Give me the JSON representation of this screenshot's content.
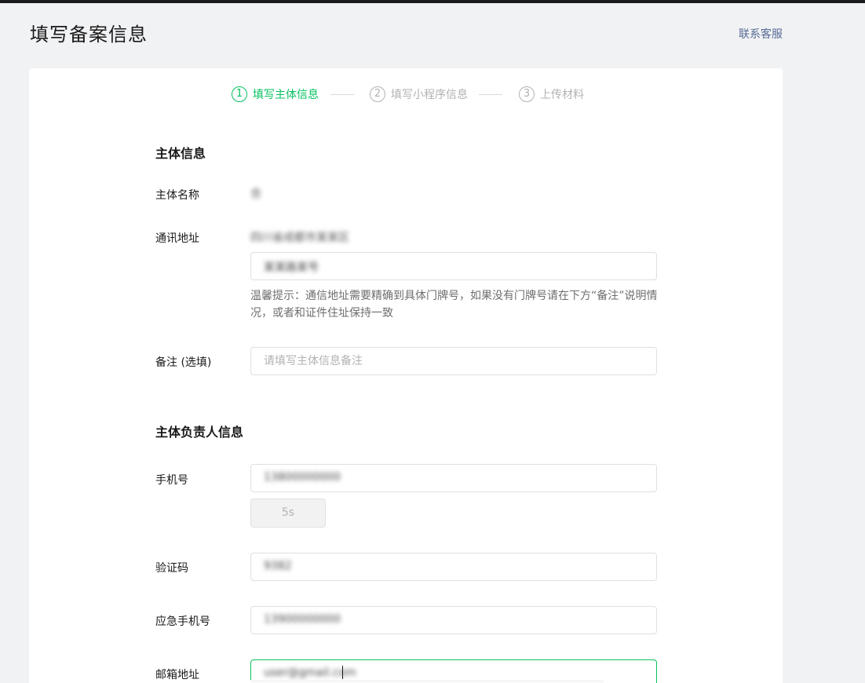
{
  "header": {
    "title": "填写备案信息",
    "contact_link": "联系客服"
  },
  "steps": [
    {
      "num": "1",
      "label": "填写主体信息",
      "active": true
    },
    {
      "num": "2",
      "label": "填写小程序信息",
      "active": false
    },
    {
      "num": "3",
      "label": "上传材料",
      "active": false
    }
  ],
  "subject": {
    "section_title": "主体信息",
    "name_label": "主体名称",
    "name_value": "合",
    "address_label": "通讯地址",
    "address_region": "四川省成都市某某区",
    "address_detail": "某某路某号",
    "address_hint": "温馨提示：通信地址需要精确到具体门牌号，如果没有门牌号请在下方“备注”说明情况，或者和证件住址保持一致",
    "remark_label": "备注 (选填)",
    "remark_placeholder": "请填写主体信息备注"
  },
  "owner": {
    "section_title": "主体负责人信息",
    "phone_label": "手机号",
    "phone_value": "13800000000",
    "countdown": "5s",
    "code_label": "验证码",
    "code_value": "9382",
    "emergency_label": "应急手机号",
    "emergency_value": "13900000000",
    "email_label": "邮箱地址",
    "email_value": "user@gmail.com"
  },
  "colors": {
    "accent": "#07c160",
    "link": "#576b95",
    "inactive": "#b2b2b2"
  }
}
